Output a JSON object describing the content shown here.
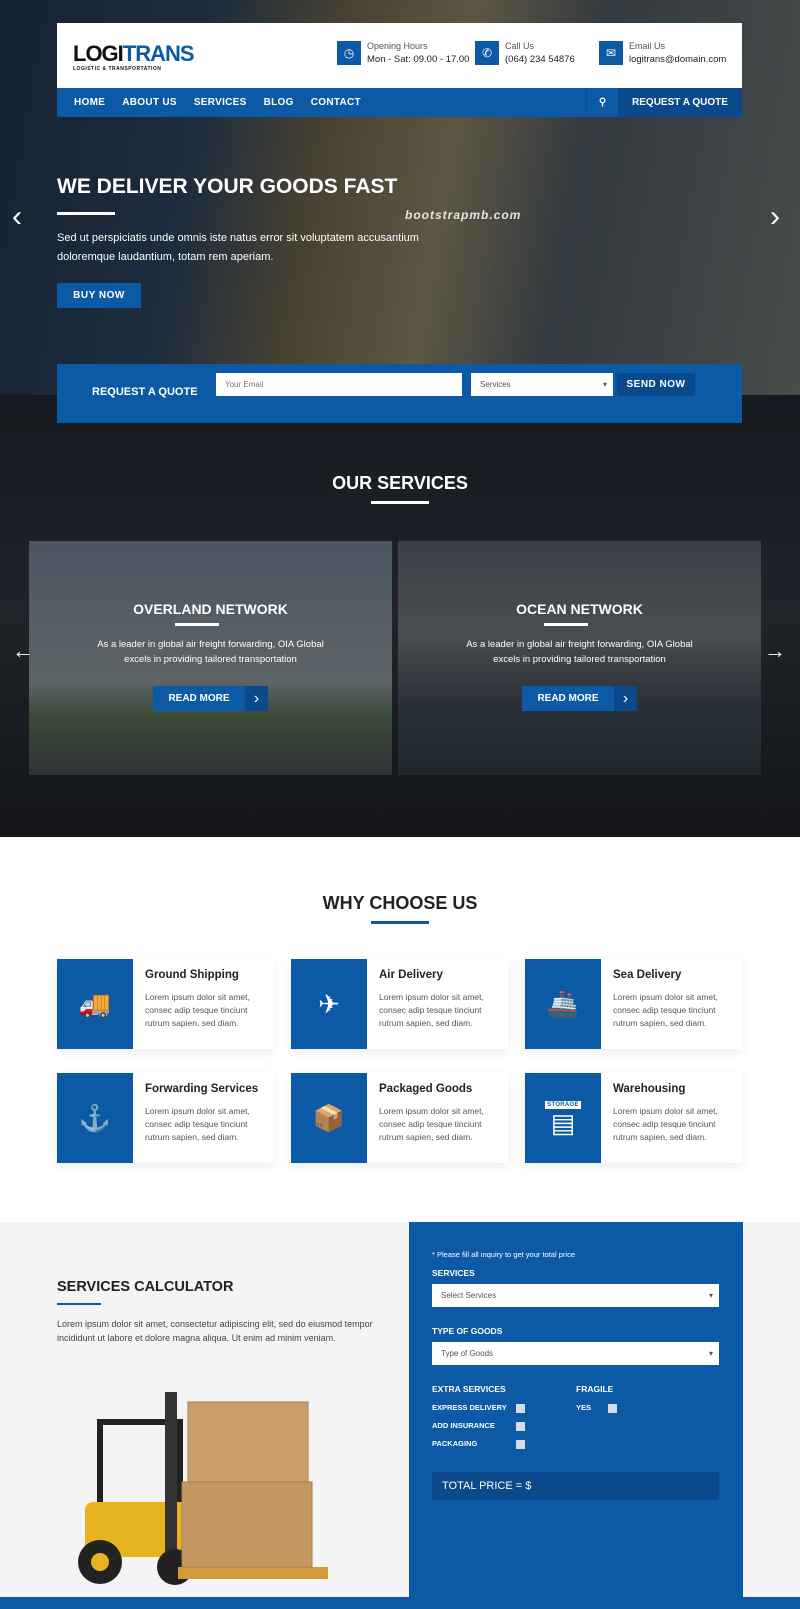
{
  "header": {
    "logo_a": "LOGI",
    "logo_b": "TRANS",
    "logo_sub": "LOGISTIC & TRANSPORTATION",
    "info": [
      {
        "icon": "clock-icon",
        "label": "Opening Hours",
        "value": "Mon - Sat: 09.00 - 17.00"
      },
      {
        "icon": "phone-icon",
        "label": "Call Us",
        "value": "(064) 234 54876"
      },
      {
        "icon": "envelope-icon",
        "label": "Email Us",
        "value": "logitrans@domain.com"
      }
    ]
  },
  "nav": {
    "items": [
      "HOME",
      "ABOUT US",
      "SERVICES",
      "BLOG",
      "CONTACT"
    ],
    "request": "REQUEST A QUOTE"
  },
  "hero": {
    "title": "WE DELIVER YOUR GOODS FAST",
    "text": "Sed ut perspiciatis unde omnis iste natus error sit voluptatem accusantium doloremque laudantium, totam rem aperiam.",
    "button": "BUY NOW",
    "watermark": "bootstrapmb.com"
  },
  "quote": {
    "label": "REQUEST A QUOTE",
    "email_placeholder": "Your Email",
    "services": "Services",
    "send": "SEND NOW"
  },
  "services": {
    "title": "OUR SERVICES",
    "cards": [
      {
        "title": "OVERLAND NETWORK",
        "text": "As a leader in global air freight forwarding, OIA Global excels in providing tailored transportation",
        "button": "READ MORE"
      },
      {
        "title": "OCEAN NETWORK",
        "text": "As a leader in global air freight forwarding, OIA Global excels in providing tailored transportation",
        "button": "READ MORE"
      }
    ]
  },
  "why": {
    "title": "WHY CHOOSE US",
    "items": [
      {
        "icon": "truck-icon",
        "title": "Ground Shipping",
        "text": "Lorem ipsum dolor sit amet, consec adip tesque tinciunt rutrum sapien, sed diam."
      },
      {
        "icon": "airplane-icon",
        "title": "Air Delivery",
        "text": "Lorem ipsum dolor sit amet, consec adip tesque tinciunt rutrum sapien, sed diam."
      },
      {
        "icon": "ship-icon",
        "title": "Sea Delivery",
        "text": "Lorem ipsum dolor sit amet, consec adip tesque tinciunt rutrum sapien, sed diam."
      },
      {
        "icon": "crane-container-icon",
        "title": "Forwarding Services",
        "text": "Lorem ipsum dolor sit amet, consec adip tesque tinciunt rutrum sapien, sed diam."
      },
      {
        "icon": "package-icon",
        "title": "Packaged Goods",
        "text": "Lorem ipsum dolor sit amet, consec adip tesque tinciunt rutrum sapien, sed diam."
      },
      {
        "icon": "storage-icon",
        "title": "Warehousing",
        "text": "Lorem ipsum dolor sit amet, consec adip tesque tinciunt rutrum sapien, sed diam.",
        "icon_text": "STORAGE"
      }
    ]
  },
  "calc": {
    "title": "SERVICES CALCULATOR",
    "text": "Lorem ipsum dolor sit amet, consectetur adipiscing elit, sed do eiusmod tempor incididunt ut labore et dolore magna aliqua. Ut enim ad minim veniam.",
    "note": "* Please fill all inquiry to get your total price",
    "services_label": "SERVICES",
    "services_value": "Select Services",
    "goods_label": "TYPE OF GOODS",
    "goods_value": "Type of Goods",
    "extra_label": "EXTRA SERVICES",
    "extras": [
      "EXPRESS DELIVERY",
      "ADD INSURANCE",
      "PACKAGING"
    ],
    "fragile_label": "FRAGILE",
    "fragile_yes": "YES",
    "total": "TOTAL PRICE = $"
  },
  "colors": {
    "brand": "#0c5aa6",
    "brand_dark": "#0a4a8c"
  }
}
